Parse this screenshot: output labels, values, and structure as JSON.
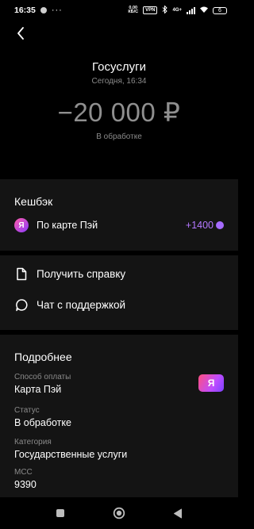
{
  "status_bar": {
    "time": "16:35",
    "more": "···",
    "speed_top": "0,00",
    "speed_bottom": "КБ/С",
    "vpn": "VPN",
    "network": "4G+",
    "battery": "6"
  },
  "header": {
    "merchant": "Госуслуги",
    "date": "Сегодня, 16:34",
    "amount": "−20 000 ₽",
    "amount_status": "В обработке"
  },
  "cashback": {
    "title": "Кешбэк",
    "icon_letter": "Я",
    "label": "По карте Пэй",
    "value": "+1400"
  },
  "actions": [
    {
      "label": "Получить справку",
      "icon": "document-icon"
    },
    {
      "label": "Чат с поддержкой",
      "icon": "chat-icon"
    }
  ],
  "details": {
    "title": "Подробнее",
    "items": [
      {
        "label": "Способ оплаты",
        "value": "Карта Пэй"
      },
      {
        "label": "Статус",
        "value": "В обработке"
      },
      {
        "label": "Категория",
        "value": "Государственные услуги"
      },
      {
        "label": "MCC",
        "value": "9390"
      }
    ],
    "badge_letter": "Я"
  },
  "colors": {
    "background": "#000000",
    "card": "#141414",
    "secondary_text": "#8b8b8b",
    "cashback_accent": "#b478ff"
  }
}
